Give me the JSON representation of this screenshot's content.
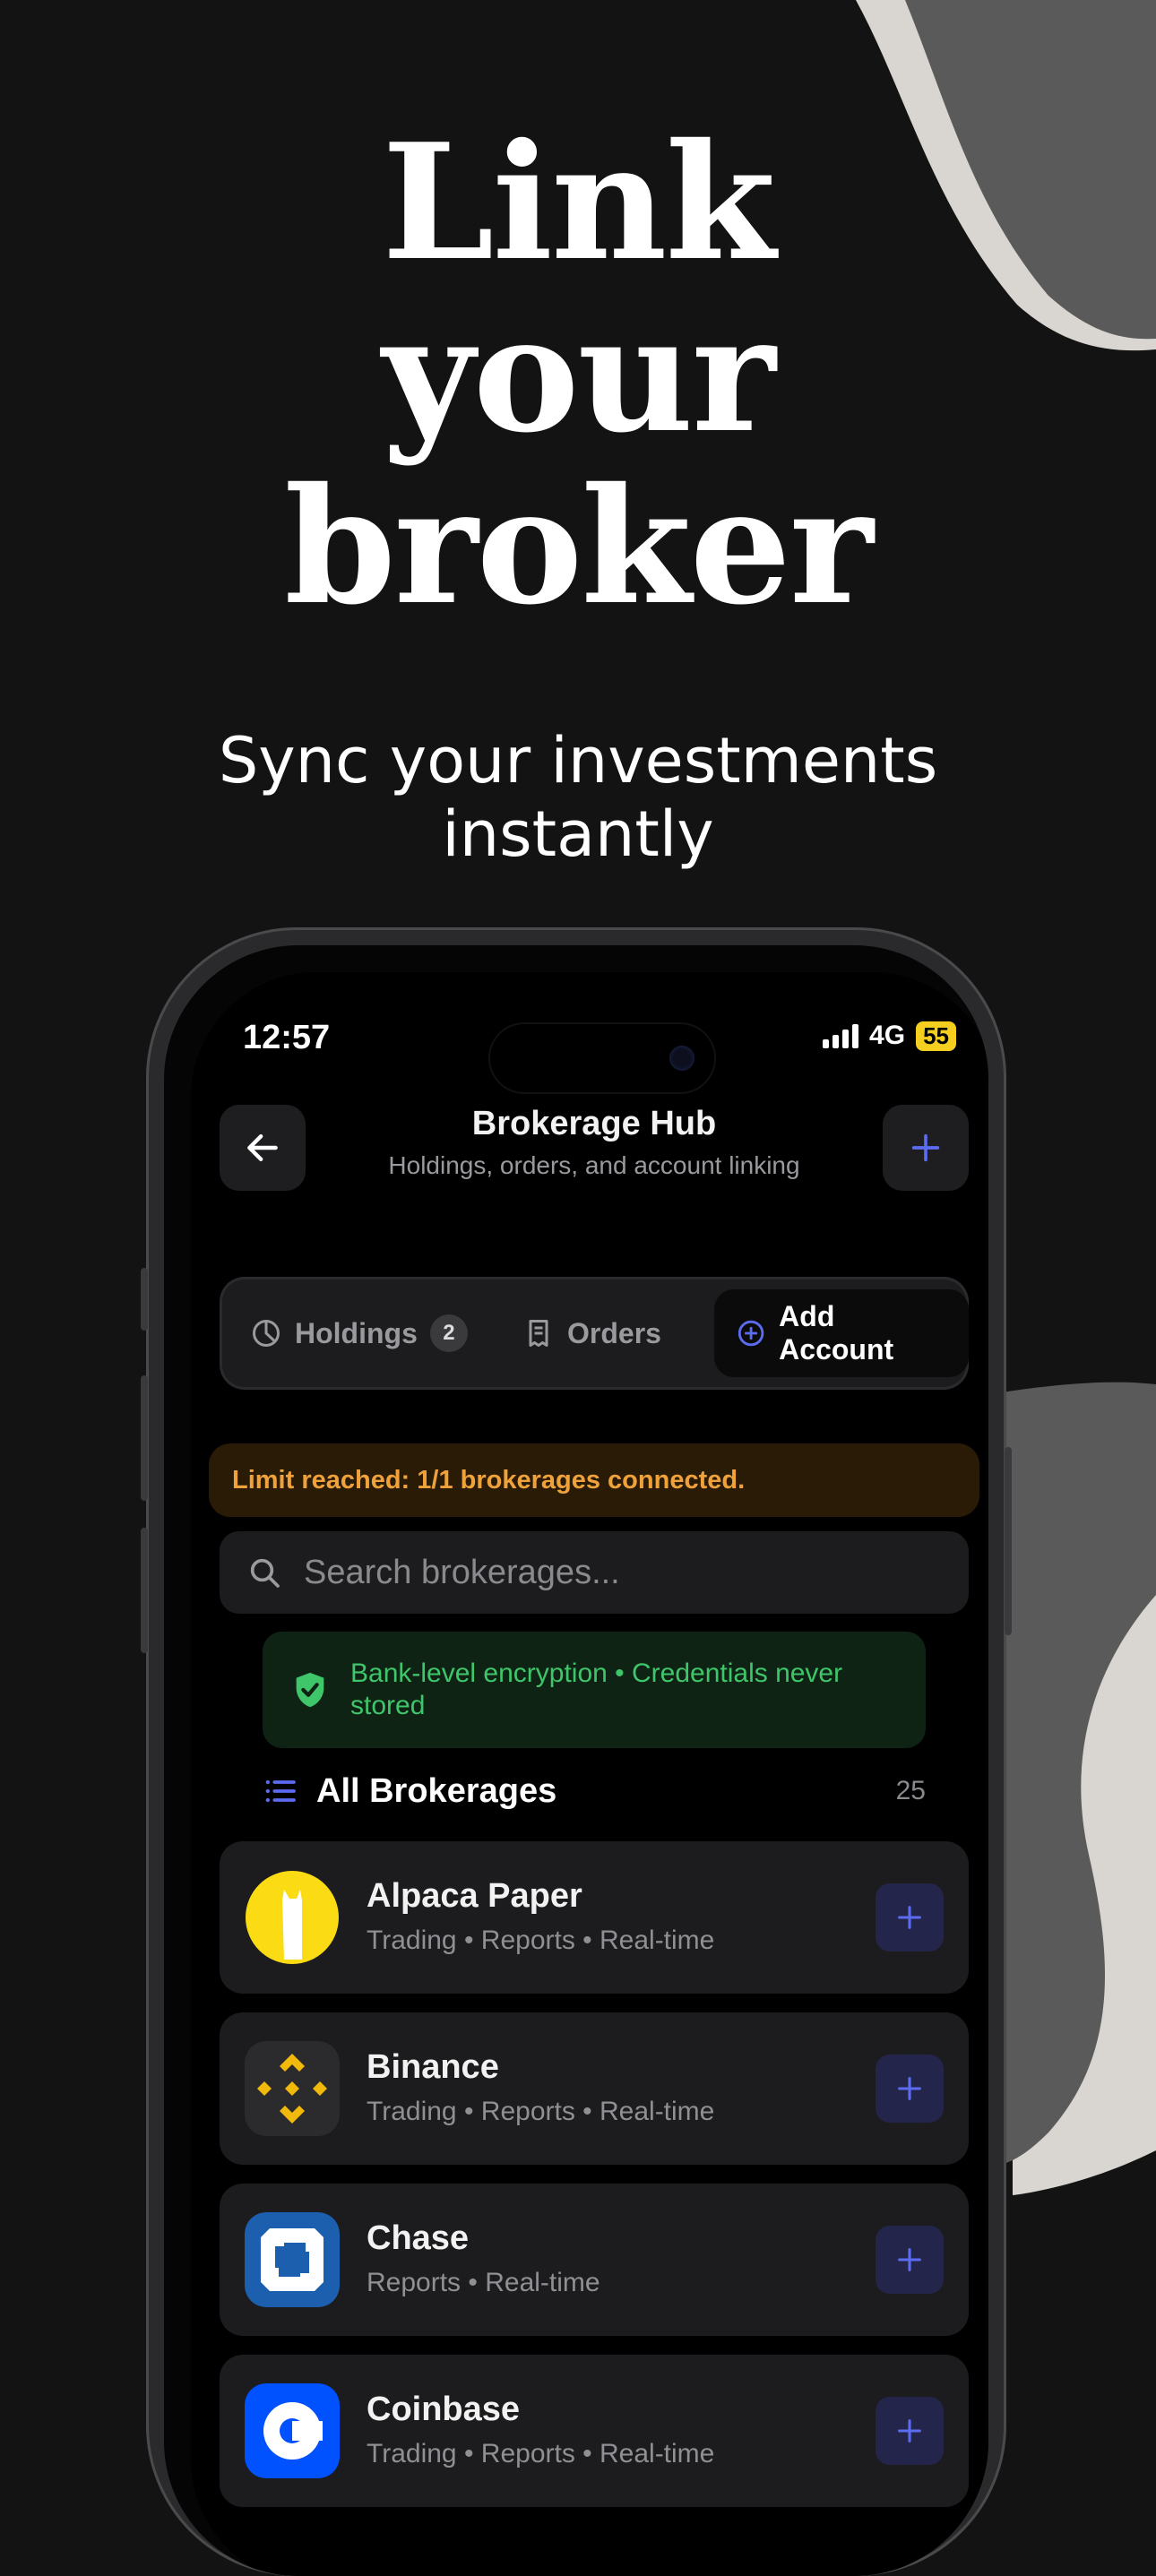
{
  "promo": {
    "headline": [
      "Link",
      "your",
      "broker"
    ],
    "subheadline": [
      "Sync your investments",
      "instantly"
    ]
  },
  "status_bar": {
    "time": "12:57",
    "network": "4G",
    "battery": "55"
  },
  "header": {
    "title": "Brokerage Hub",
    "subtitle": "Holdings, orders, and account linking",
    "back_icon": "arrow-left-icon",
    "add_icon": "plus-icon"
  },
  "tabs": [
    {
      "label": "Holdings",
      "icon": "pie-chart-icon",
      "badge": "2",
      "active": false
    },
    {
      "label": "Orders",
      "icon": "receipt-icon",
      "active": false
    },
    {
      "label": "Add Account",
      "icon": "plus-circle-icon",
      "active": true
    }
  ],
  "alert": {
    "text": "Limit reached: 1/1 brokerages connected."
  },
  "search": {
    "placeholder": "Search brokerages..."
  },
  "security_note": {
    "text": "Bank-level encryption • Credentials never stored",
    "icon": "shield-check-icon"
  },
  "section": {
    "title": "All Brokerages",
    "count": "25",
    "icon": "list-icon"
  },
  "brokerages": [
    {
      "name": "Alpaca Paper",
      "capabilities": "Trading • Reports • Real-time",
      "logo": "alpaca-logo"
    },
    {
      "name": "Binance",
      "capabilities": "Trading • Reports • Real-time",
      "logo": "binance-logo"
    },
    {
      "name": "Chase",
      "capabilities": "Reports • Real-time",
      "logo": "chase-logo"
    },
    {
      "name": "Coinbase",
      "capabilities": "Trading • Reports • Real-time",
      "logo": "coinbase-logo"
    }
  ],
  "colors": {
    "background": "#131313",
    "accent": "#5b6cf2",
    "warning": "#f0a23a",
    "success": "#3fc56a",
    "decor_light": "#d9d6d1",
    "decor_dark": "#5a5a5a"
  }
}
